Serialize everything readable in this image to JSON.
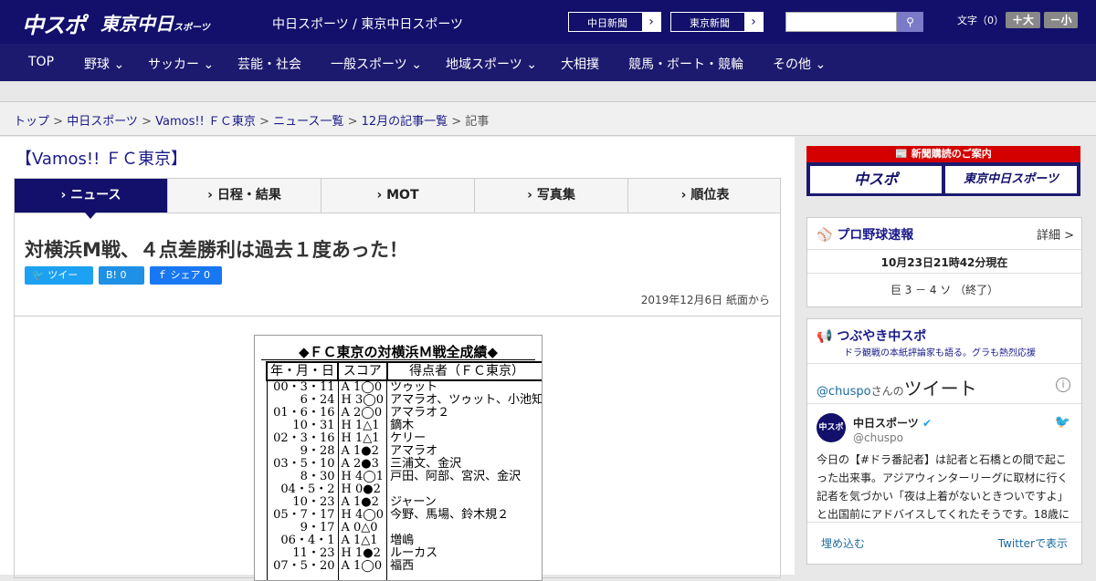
{
  "header": {
    "logo_chuspo": "中スポ",
    "logo_tokyo": "東京中日",
    "logo_tokyo_small": "スポーツ",
    "site_title": "中日スポーツ / 東京中日スポーツ",
    "ext_links": [
      "中日新聞",
      "東京新聞"
    ],
    "search_placeholder": "",
    "font_size_label": "文字（0）",
    "font_plus": "＋大",
    "font_minus": "－小"
  },
  "nav": [
    "TOP",
    "野球",
    "サッカー",
    "芸能・社会",
    "一般スポーツ",
    "地域スポーツ",
    "大相撲",
    "競馬・ボート・競輪",
    "その他"
  ],
  "breadcrumb": [
    "トップ",
    "中日スポーツ",
    "Vamos!! ＦＣ東京",
    "ニュース一覧",
    "12月の記事一覧",
    "記事"
  ],
  "section_title": "【Vamos!! ＦＣ東京】",
  "tabs": [
    "ニュース",
    "日程・結果",
    "MOT",
    "写真集",
    "順位表"
  ],
  "article": {
    "headline": "対横浜M戦、４点差勝利は過去１度あった！",
    "tweet_btn": "ツイート",
    "hatena_btn": "B! 0",
    "fb_btn": "シェア 0",
    "date": "2019年12月6日 紙面から",
    "photo_title": "◆ＦＣ東京の対横浜Ｍ戦全成績◆",
    "table_headers": [
      "年・月・日",
      "スコア",
      "得点者（ＦＣ東京）"
    ],
    "table_rows": [
      [
        "00・3・11",
        "A 1◯0",
        "ツゥット"
      ],
      [
        "6・24",
        "H 3◯0",
        "アマラオ、ツゥット、小池知"
      ],
      [
        "01・6・16",
        "A 2◯0",
        "アマラオ２"
      ],
      [
        "10・31",
        "H 1△1",
        "鏑木"
      ],
      [
        "02・3・16",
        "H 1△1",
        "ケリー"
      ],
      [
        "9・28",
        "A 1●2",
        "アマラオ"
      ],
      [
        "03・5・10",
        "A 2●3",
        "三浦文、金沢"
      ],
      [
        "8・30",
        "H 4◯1",
        "戸田、阿部、宮沢、金沢"
      ],
      [
        "04・5・2",
        "H 0●2",
        ""
      ],
      [
        "10・23",
        "A 1●2",
        "ジャーン"
      ],
      [
        "05・7・17",
        "H 4◯0",
        "今野、馬場、鈴木規２"
      ],
      [
        "9・17",
        "A 0△0",
        ""
      ],
      [
        "06・4・1",
        "A 1△1",
        "増嶋"
      ],
      [
        "11・23",
        "H 1●2",
        "ルーカス"
      ],
      [
        "07・5・20",
        "A 1◯0",
        "福西"
      ],
      [
        "",
        "",
        ""
      ]
    ]
  },
  "sidebar": {
    "sub_head": "新聞購読のご案内",
    "sub_btn1": "中スポ",
    "sub_btn2": "東京中日スポーツ",
    "baseball_title": "プロ野球速報",
    "baseball_detail": "詳細 >",
    "baseball_time": "10月23日21時42分現在",
    "baseball_score": "巨 3 － 4 ソ （終了）",
    "tsubuyaki_title": "つぶやき中スポ",
    "tsubuyaki_sub": "ドラ観戦の本紙評論家も語る。グラも熱烈応援",
    "tw_by_handle": "@chuspo",
    "tw_by_suffix": "さんの",
    "tw_label": "ツイート",
    "tw_name": "中日スポーツ",
    "tw_handle": "@chuspo",
    "tw_text": "今日の【#ドラ番記者】は記者と石橋との間で起こった出来事。アジアウィンターリーグに取材に行く記者を気づかい「夜は上着がないときついですよ」と出国前にアドバイスしてくれたそうです。18歳に",
    "tw_embed": "埋め込む",
    "tw_view": "Twitterで表示"
  },
  "colors": {
    "primary": "#12106b",
    "nav": "#1c1a6e",
    "accent_red": "#d40000",
    "twitter": "#1da1f2"
  }
}
